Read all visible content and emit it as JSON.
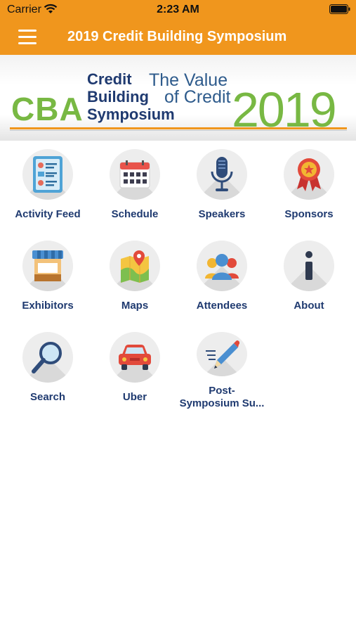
{
  "status_bar": {
    "carrier": "Carrier",
    "time": "2:23 AM"
  },
  "header": {
    "title": "2019 Credit Building Symposium"
  },
  "banner": {
    "org": "CBA",
    "event_lines": [
      "Credit",
      "Building",
      "Symposium"
    ],
    "tagline_lines": [
      "The Value",
      "of Credit"
    ],
    "year": "2019"
  },
  "menu": [
    {
      "label": "Activity Feed",
      "icon": "activity-feed-icon"
    },
    {
      "label": "Schedule",
      "icon": "calendar-icon"
    },
    {
      "label": "Speakers",
      "icon": "microphone-icon"
    },
    {
      "label": "Sponsors",
      "icon": "ribbon-badge-icon"
    },
    {
      "label": "Exhibitors",
      "icon": "booth-icon"
    },
    {
      "label": "Maps",
      "icon": "map-pin-icon"
    },
    {
      "label": "Attendees",
      "icon": "people-icon"
    },
    {
      "label": "About",
      "icon": "info-icon"
    },
    {
      "label": "Search",
      "icon": "magnifier-icon"
    },
    {
      "label": "Uber",
      "icon": "car-icon"
    },
    {
      "label": "Post-Symposium Su...",
      "icon": "pencil-survey-icon"
    }
  ],
  "colors": {
    "brand_orange": "#f0961d",
    "label_navy": "#1f3a70",
    "logo_green": "#78b843"
  }
}
